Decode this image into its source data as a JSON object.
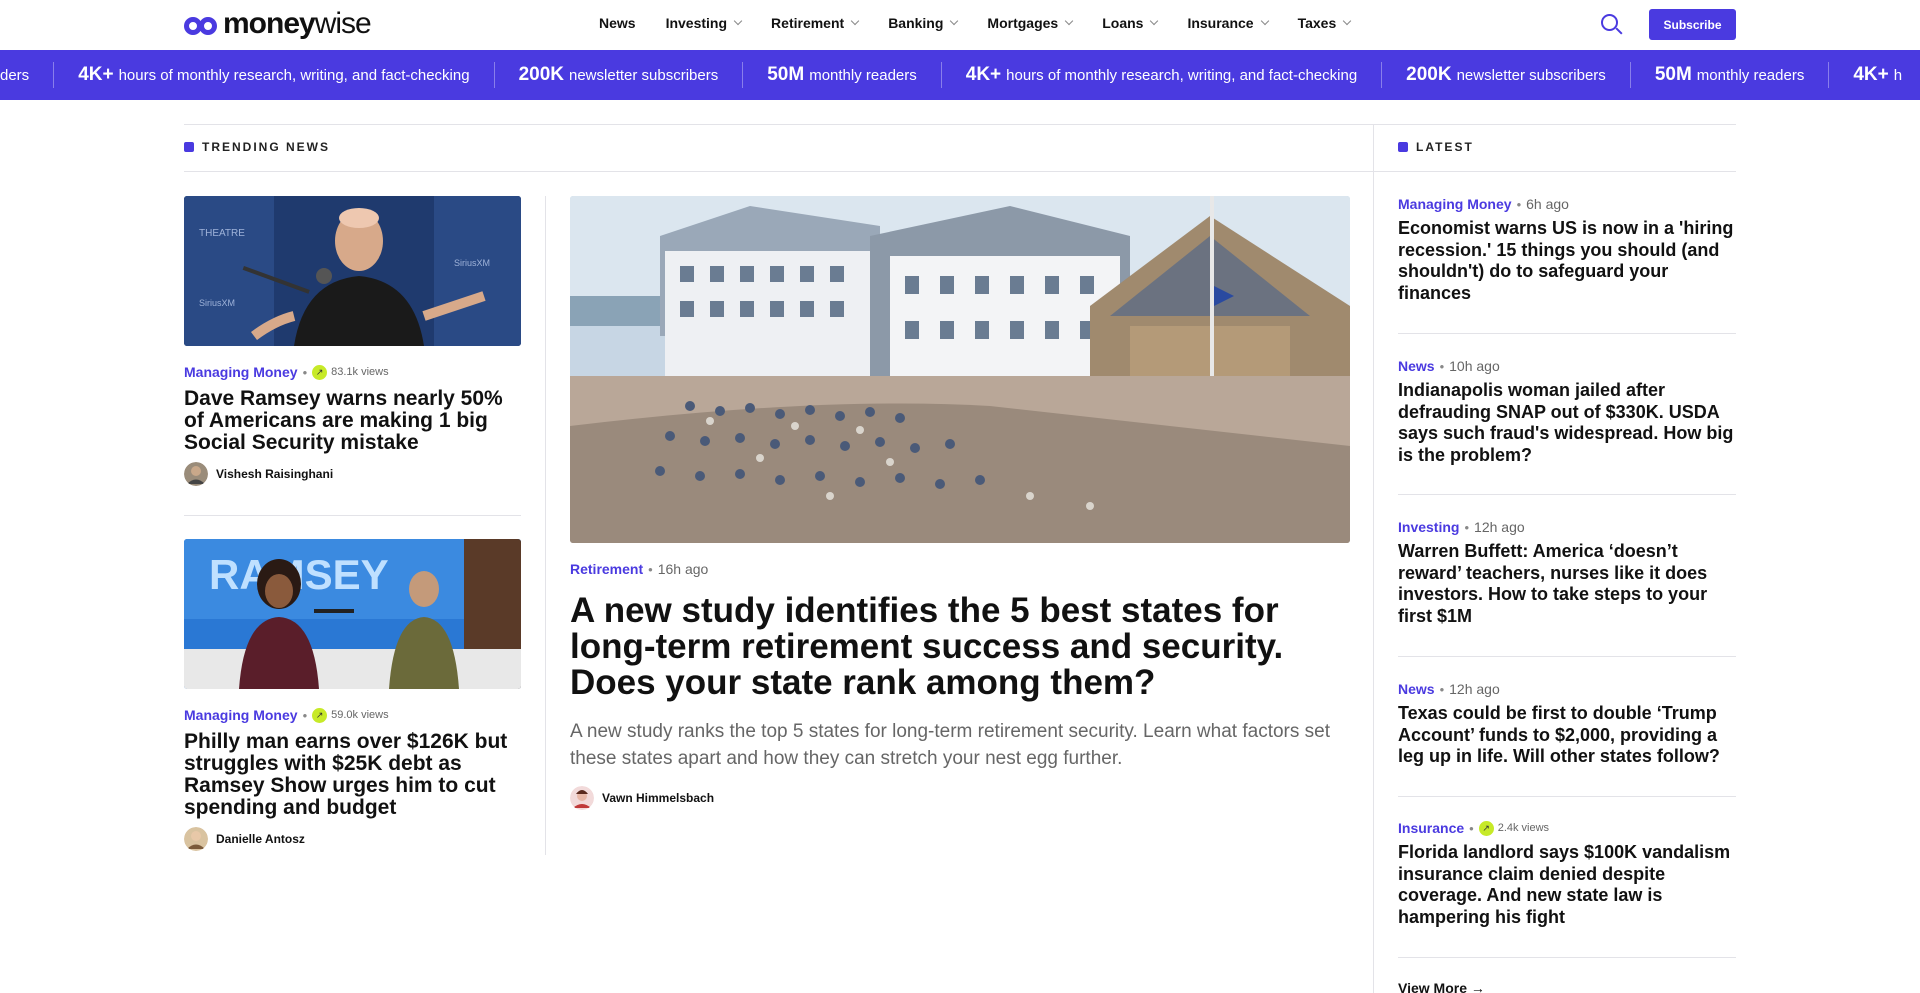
{
  "header": {
    "logo": {
      "part1": "money",
      "part2": "wise"
    },
    "nav": [
      {
        "label": "News",
        "dropdown": false
      },
      {
        "label": "Investing",
        "dropdown": true
      },
      {
        "label": "Retirement",
        "dropdown": true
      },
      {
        "label": "Banking",
        "dropdown": true
      },
      {
        "label": "Mortgages",
        "dropdown": true
      },
      {
        "label": "Loans",
        "dropdown": true
      },
      {
        "label": "Insurance",
        "dropdown": true
      },
      {
        "label": "Taxes",
        "dropdown": true
      }
    ],
    "search_icon": "search-icon",
    "subscribe_label": "Subscribe"
  },
  "ticker": {
    "items": [
      {
        "num": "",
        "text": "ders"
      },
      {
        "num": "4K+",
        "text": "hours of monthly research, writing, and fact-checking"
      },
      {
        "num": "200K",
        "text": "newsletter subscribers"
      },
      {
        "num": "50M",
        "text": "monthly readers"
      },
      {
        "num": "4K+",
        "text": "hours of monthly research, writing, and fact-checking"
      },
      {
        "num": "200K",
        "text": "newsletter subscribers"
      },
      {
        "num": "50M",
        "text": "monthly readers"
      },
      {
        "num": "4K+",
        "text": "h"
      }
    ]
  },
  "trending": {
    "label": "TRENDING NEWS",
    "cards": [
      {
        "category": "Managing Money",
        "views": "83.1k views",
        "title": "Dave Ramsey warns nearly 50% of Americans are making 1 big Social Security mistake",
        "author": "Vishesh Raisinghani"
      },
      {
        "category": "Managing Money",
        "views": "59.0k views",
        "title": "Philly man earns over $126K but struggles with $25K debt as Ramsey Show urges him to cut spending and budget",
        "author": "Danielle Antosz"
      }
    ],
    "featured": {
      "category": "Retirement",
      "age": "16h ago",
      "title": "A new study identifies the 5 best states for long-term retirement success and security. Does your state rank among them?",
      "description": "A new study ranks the top 5 states for long-term retirement security. Learn what factors set these states apart and how they can stretch your nest egg further.",
      "author": "Vawn Himmelsbach"
    }
  },
  "latest": {
    "label": "LATEST",
    "items": [
      {
        "category": "Managing Money",
        "age": "6h ago",
        "views": "",
        "title": "Economist warns US is now in a 'hiring recession.' 15 things you should (and shouldn't) do to safeguard your finances"
      },
      {
        "category": "News",
        "age": "10h ago",
        "views": "",
        "title": "Indianapolis woman jailed after defrauding SNAP out of $330K. USDA says such fraud's widespread. How big is the problem?"
      },
      {
        "category": "Investing",
        "age": "12h ago",
        "views": "",
        "title": "Warren Buffett: America ‘doesn’t reward’ teachers, nurses like it does investors. How to take steps to your first $1M"
      },
      {
        "category": "News",
        "age": "12h ago",
        "views": "",
        "title": "Texas could be first to double ‘Trump Account’ funds to $2,000, providing a leg up in life. Will other states follow?"
      },
      {
        "category": "Insurance",
        "age": "",
        "views": "2.4k views",
        "title": "Florida landlord says $100K vandalism insurance claim denied despite coverage. And new state law is hampering his fight"
      }
    ],
    "view_more": "View More"
  },
  "colors": {
    "brand": "#4a3ae0",
    "views_badge": "#c7ea28"
  }
}
